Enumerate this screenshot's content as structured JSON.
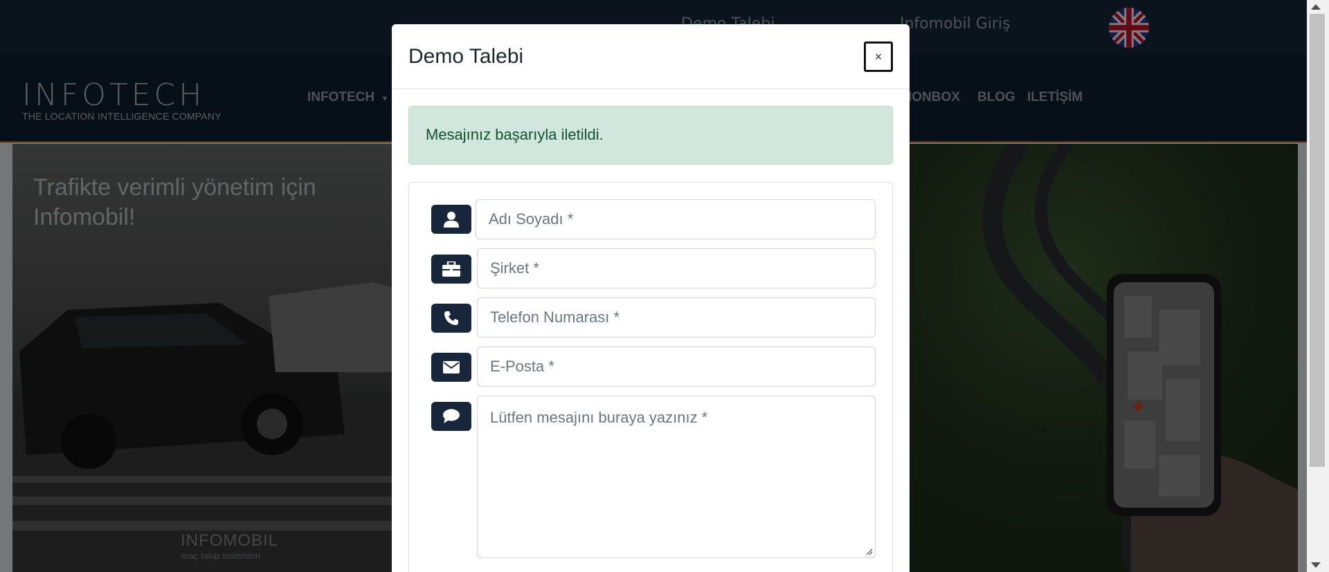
{
  "topbar": {
    "demo_link": "Demo Talebi",
    "login_link": "Infomobil Giriş",
    "flag_icon": "uk-flag-icon"
  },
  "logo": {
    "main": "INFOTECH",
    "tagline": "THE  LOCATION INTELLIGENCE COMPANY"
  },
  "nav": {
    "items": [
      {
        "label": "INFOTECH",
        "has_dropdown": true
      },
      {
        "label": "IONBOX"
      },
      {
        "label": "BLOG"
      },
      {
        "label": "ILETİŞİM"
      }
    ]
  },
  "hero": {
    "title_line1": "Trafikte verimli yönetim için",
    "title_line2": "Infomobil!",
    "brand_name": "INFOMOBIL",
    "brand_sub": "araç takip sistemleri"
  },
  "modal": {
    "title": "Demo Talebi",
    "close_label": "×",
    "alert": "Mesajınız başarıyla iletildi.",
    "fields": {
      "name_placeholder": "Adı Soyadı *",
      "company_placeholder": "Şirket *",
      "phone_placeholder": "Telefon Numarası *",
      "email_placeholder": "E-Posta *",
      "message_placeholder": "Lütfen mesajını buraya yazınız *"
    },
    "icons": [
      "user-icon",
      "briefcase-icon",
      "phone-icon",
      "envelope-icon",
      "comment-icon"
    ]
  },
  "colors": {
    "navy": "#17263a",
    "alert_bg": "#d1e7dd",
    "alert_text": "#0f5132",
    "nav_accent": "#b35a24"
  }
}
